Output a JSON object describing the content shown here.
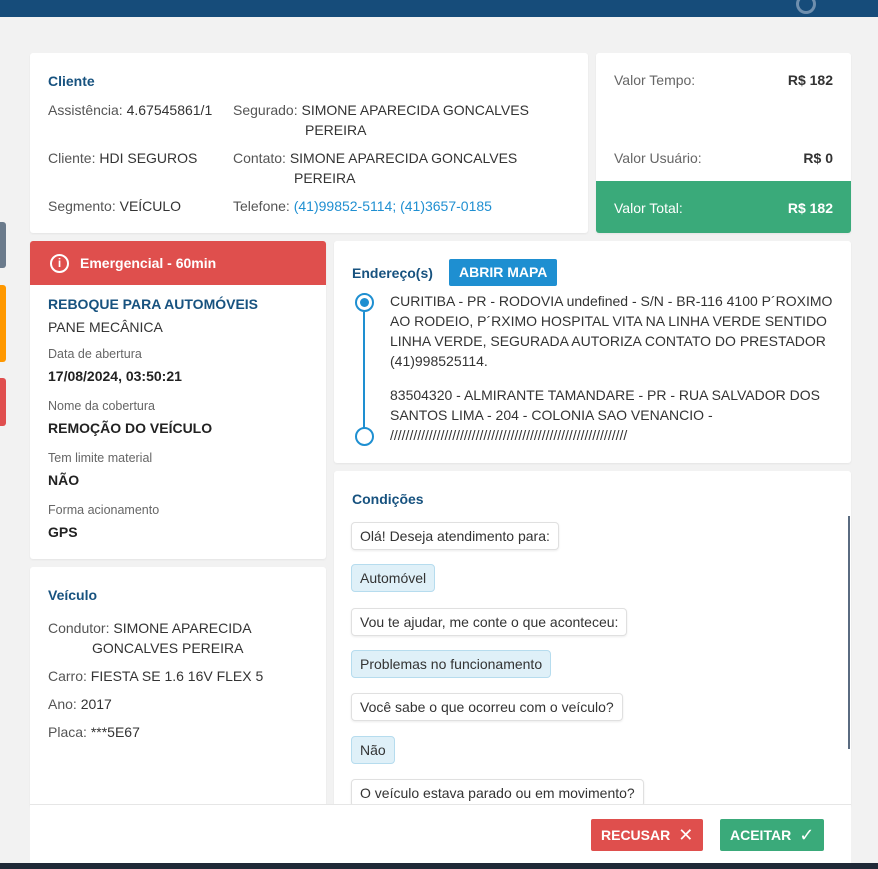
{
  "colors": {
    "header": "#164c7a",
    "accent_blue": "#1e8fd1",
    "emergency_red": "#df4f4d",
    "total_green": "#3aaa7a",
    "refuse_red": "#df4f4d",
    "accept_green": "#3aaa7a"
  },
  "client": {
    "title": "Cliente",
    "assistencia_label": "Assistência:",
    "assistencia_value": "4.67545861/1",
    "segurado_label": "Segurado:",
    "segurado_value_1": "SIMONE APARECIDA GONCALVES",
    "segurado_value_2": "PEREIRA",
    "cliente_label": "Cliente:",
    "cliente_value": "HDI SEGUROS",
    "contato_label": "Contato:",
    "contato_value_1": "SIMONE APARECIDA GONCALVES",
    "contato_value_2": "PEREIRA",
    "segmento_label": "Segmento:",
    "segmento_value": "VEÍCULO",
    "telefone_label": "Telefone:",
    "telefone_value": "(41)99852-5114; (41)3657-0185"
  },
  "values": {
    "tempo_label": "Valor Tempo:",
    "tempo_value": "R$ 182",
    "usuario_label": "Valor Usuário:",
    "usuario_value": "R$ 0",
    "total_label": "Valor Total:",
    "total_value": "R$ 182"
  },
  "service": {
    "emergency_label": "Emergencial - 60min",
    "emergency_icon": "info-icon",
    "service_type": "REBOQUE PARA AUTOMÓVEIS",
    "problem": "PANE MECÂNICA",
    "opened_label": "Data de abertura",
    "opened_value": "17/08/2024, 03:50:21",
    "coverage_label": "Nome da cobertura",
    "coverage_value": "REMOÇÃO DO VEÍCULO",
    "limit_label": "Tem limite material",
    "limit_value": "NÃO",
    "trigger_label": "Forma acionamento",
    "trigger_value": "GPS"
  },
  "vehicle": {
    "title": "Veículo",
    "driver_label": "Condutor:",
    "driver_value_1": "SIMONE APARECIDA",
    "driver_value_2": "GONCALVES PEREIRA",
    "car_label": "Carro:",
    "car_value": "FIESTA SE 1.6 16V FLEX 5",
    "year_label": "Ano:",
    "year_value": "2017",
    "plate_label": "Placa:",
    "plate_value": "***5E67"
  },
  "address": {
    "title": "Endereço(s)",
    "map_button": "ABRIR MAPA",
    "origin_lines": [
      "CURITIBA - PR - RODOVIA undefined - S/N - BR-116 4100 P´ROXIMO",
      "AO RODEIO, P´RXIMO HOSPITAL VITA NA LINHA VERDE SENTIDO",
      "LINHA VERDE, SEGURADA AUTORIZA CONTATO DO PRESTADOR",
      "(41)998525114."
    ],
    "destination_lines": [
      "83504320 - ALMIRANTE TAMANDARE - PR - RUA SALVADOR DOS",
      "SANTOS LIMA - 204 - COLONIA SAO VENANCIO -",
      "/////////////////////////////////////////////////////////////"
    ]
  },
  "conditions": {
    "title": "Condições",
    "messages": [
      {
        "type": "question",
        "text": "Olá! Deseja atendimento para:"
      },
      {
        "type": "answer",
        "text": "Automóvel"
      },
      {
        "type": "question",
        "text": "Vou te ajudar, me conte o que aconteceu:"
      },
      {
        "type": "answer",
        "text": "Problemas no funcionamento"
      },
      {
        "type": "question",
        "text": "Você sabe o que ocorreu com o veículo?"
      },
      {
        "type": "answer",
        "text": "Não"
      },
      {
        "type": "question",
        "text": "O veículo estava parado ou em movimento?"
      }
    ]
  },
  "actions": {
    "refuse_label": "RECUSAR",
    "refuse_icon": "close-icon",
    "accept_label": "ACEITAR",
    "accept_icon": "check-icon"
  }
}
